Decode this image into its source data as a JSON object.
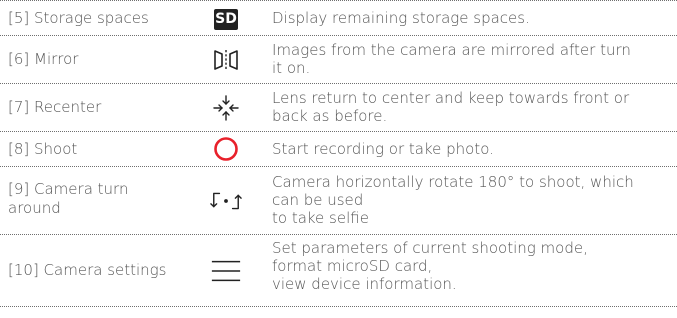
{
  "rows": [
    {
      "name": "[5] Storage spaces",
      "icon": "sd-card-icon",
      "icon_text": "SD",
      "desc": "Display remaining storage spaces."
    },
    {
      "name": "[6] Mirror",
      "icon": "mirror-icon",
      "desc": "Images from the camera are mirrored after turn\nit on."
    },
    {
      "name": "[7] Recenter",
      "icon": "recenter-icon",
      "desc": "Lens return to center and keep towards front or\nback as before."
    },
    {
      "name": "[8] Shoot",
      "icon": "shoot-icon",
      "desc": "Start recording or take photo."
    },
    {
      "name": "[9] Camera turn around",
      "icon": "camera-turn-around-icon",
      "desc": "Camera horizontally rotate 180° to shoot, which\ncan be used\nto take selfie"
    },
    {
      "name": "[10] Camera settings",
      "icon": "settings-menu-icon",
      "desc": "Set parameters of current shooting mode,\nformat microSD card,\nview device information."
    }
  ],
  "colors": {
    "shoot": "#e8212b",
    "text": "#555555",
    "rule": "#6f6f6f"
  }
}
